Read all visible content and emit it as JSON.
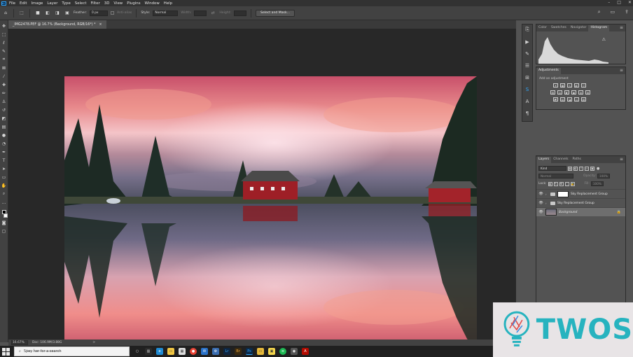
{
  "menubar": {
    "app_icon": "Ps",
    "items": [
      "File",
      "Edit",
      "Image",
      "Layer",
      "Type",
      "Select",
      "Filter",
      "3D",
      "View",
      "Plugins",
      "Window",
      "Help"
    ]
  },
  "options": {
    "feather_label": "Feather:",
    "feather_value": "0 px",
    "antialias_label": "Anti-alias",
    "style_label": "Style:",
    "style_value": "Normal",
    "width_label": "Width:",
    "height_label": "Height:",
    "select_mask_label": "Select and Mask..."
  },
  "document": {
    "tab_title": "_IMG2478.PEF @ 16.7% (Background, RGB/16*) *",
    "tab_close": "×"
  },
  "statusbar": {
    "zoom": "16.67%",
    "doc_info": "Doc: 106.9M/3.88G",
    "arrow": ">"
  },
  "panels": {
    "top_tabs": [
      "Color",
      "Swatches",
      "Navigator",
      "Histogram"
    ],
    "adjustments": {
      "tab": "Adjustments",
      "hint": "Add an adjustment"
    },
    "layers": {
      "tabs": [
        "Layers",
        "Channels",
        "Paths"
      ],
      "kind_label": "Kind",
      "blend_mode": "Normal",
      "opacity_label": "Opacity:",
      "opacity_value": "100%",
      "lock_label": "Lock:",
      "fill_label": "Fill:",
      "fill_value": "100%",
      "items": [
        {
          "name": "Sky Replacement Group"
        },
        {
          "name": "Sky Replacement Group"
        },
        {
          "name": "Background"
        }
      ]
    }
  },
  "taskbar": {
    "search_placeholder": "Sṗ̵e̶y̶ ḣ̶e̶r̶ f̶o̶r̶ ̶a̶ ̶s̶e̶a̶r̶c̶h̶"
  },
  "watermark": {
    "text": "TWOS"
  },
  "colors": {
    "ps_blue": "#31a8ff",
    "watermark_teal": "#27b3bf",
    "panel_bg": "#535353",
    "canvas_bg": "#282828"
  }
}
